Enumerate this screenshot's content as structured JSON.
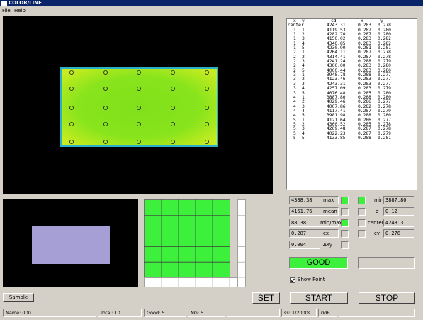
{
  "window": {
    "title": "COLOR/LINE"
  },
  "menu": {
    "file": "File",
    "help": "Help"
  },
  "table": {
    "headers": [
      "x",
      "y",
      "cd",
      "x",
      "y"
    ],
    "rows": [
      [
        "center",
        "",
        "4243.31",
        "0.283",
        "0.278"
      ],
      [
        "1",
        "1",
        "4119.53",
        "0.282",
        "0.280"
      ],
      [
        "1",
        "2",
        "4282.70",
        "0.287",
        "0.280"
      ],
      [
        "1",
        "3",
        "4150.02",
        "0.283",
        "0.282"
      ],
      [
        "1",
        "4",
        "4340.85",
        "0.283",
        "0.282"
      ],
      [
        "1",
        "5",
        "4230.90",
        "0.281",
        "0.281"
      ],
      [
        "2",
        "1",
        "4264.11",
        "0.287",
        "0.278"
      ],
      [
        "2",
        "2",
        "4314.41",
        "0.287",
        "0.278"
      ],
      [
        "2",
        "3",
        "4241.24",
        "0.288",
        "0.279"
      ],
      [
        "2",
        "4",
        "4300.00",
        "0.283",
        "0.280"
      ],
      [
        "2",
        "5",
        "4000.44",
        "0.283",
        "0.280"
      ],
      [
        "3",
        "1",
        "3948.78",
        "0.288",
        "0.277"
      ],
      [
        "3",
        "2",
        "4123.46",
        "0.283",
        "0.277"
      ],
      [
        "3",
        "3",
        "4243.31",
        "0.283",
        "0.277"
      ],
      [
        "3",
        "4",
        "4257.09",
        "0.283",
        "0.279"
      ],
      [
        "3",
        "5",
        "4076.48",
        "0.285",
        "0.280"
      ],
      [
        "4",
        "1",
        "3887.80",
        "0.288",
        "0.280"
      ],
      [
        "4",
        "2",
        "4029.46",
        "0.286",
        "0.277"
      ],
      [
        "4",
        "3",
        "4007.86",
        "0.282",
        "0.278"
      ],
      [
        "4",
        "4",
        "4117.41",
        "0.287",
        "0.279"
      ],
      [
        "4",
        "5",
        "3981.98",
        "0.288",
        "0.280"
      ],
      [
        "5",
        "1",
        "4121.64",
        "0.286",
        "0.277"
      ],
      [
        "5",
        "2",
        "4300.52",
        "0.285",
        "0.278"
      ],
      [
        "5",
        "3",
        "4269.48",
        "0.287",
        "0.278"
      ],
      [
        "5",
        "4",
        "4022.23",
        "0.287",
        "0.279"
      ],
      [
        "5",
        "5",
        "4133.85",
        "0.288",
        "0.281"
      ]
    ]
  },
  "stats": {
    "max_value": "4388.38",
    "max_label": "max",
    "mean_value": "4161.76",
    "mean_label": "mean",
    "minmax_value": "88.38",
    "minmax_label": "min/max",
    "cx_value": "0.287",
    "cx_label": "cx",
    "dxy_value": "0.004",
    "dxy_label": "Δxy",
    "min_label": "min",
    "min_value": "3887.80",
    "sigma_label": "σ",
    "sigma_value": "0.12",
    "center_label": "center",
    "center_value": "4243.31",
    "cy_label": "cy",
    "cy_value": "0.278"
  },
  "result": {
    "status": "GOOD",
    "status_color": "#3cf03c"
  },
  "show_point": {
    "label": "Show Point",
    "checked": true
  },
  "buttons": {
    "sample": "Sample",
    "set": "SET",
    "start": "START",
    "stop": "STOP"
  },
  "statusbar": {
    "name": "Name: 000",
    "total": "Total: 10",
    "good": "Good: 5",
    "ng": "NG: 5",
    "ss": "ss: 1/2000s",
    "db": "0dB"
  },
  "colors": {
    "panel_green": "#3cf03c",
    "bg": "#d4d0c8",
    "titlebar": "#0a246a"
  }
}
